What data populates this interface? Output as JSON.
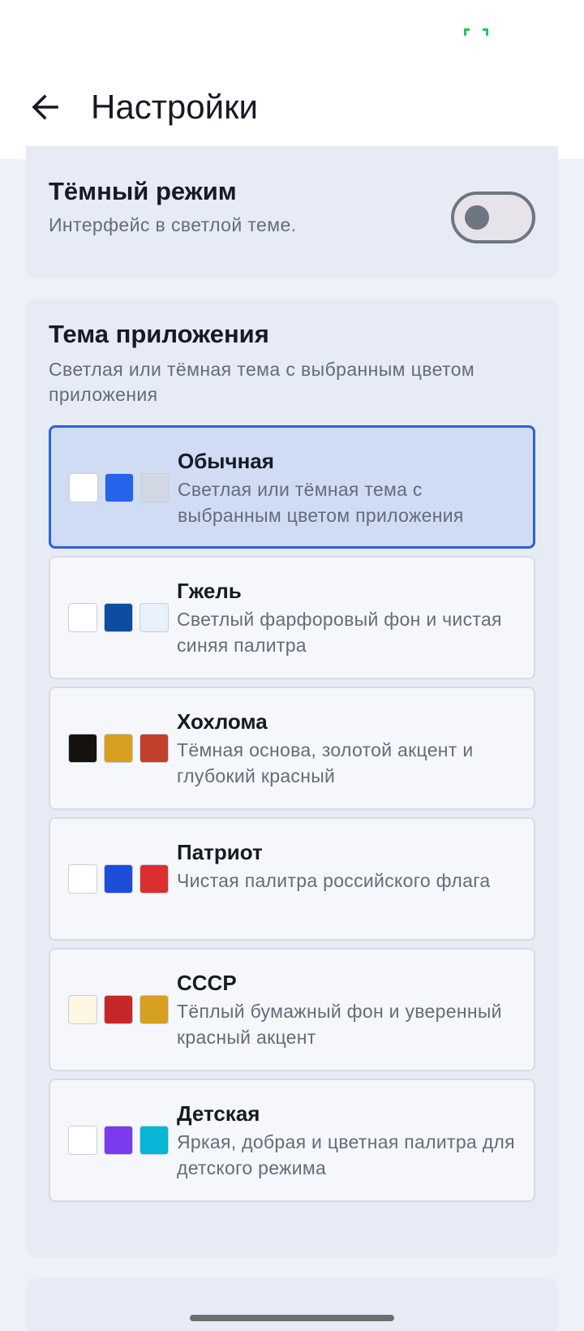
{
  "header": {
    "title": "Настройки",
    "back_icon": "arrow-left-icon"
  },
  "status_bar": {
    "indicator_icon": "screen-record-icon",
    "indicator_color": "#22c55e"
  },
  "dark_mode": {
    "title": "Тёмный режим",
    "subtitle": "Интерфейс в светлой теме.",
    "enabled": false
  },
  "theme": {
    "title": "Тема приложения",
    "subtitle": "Светлая или тёмная тема с выбранным цветом приложения",
    "options": [
      {
        "name": "Обычная",
        "description": "Светлая или тёмная тема с выбранным цветом приложения",
        "selected": true,
        "swatches": [
          "#ffffff",
          "#2563eb",
          "#d2d8e3"
        ]
      },
      {
        "name": "Гжель",
        "description": "Светлый фарфоровый фон и чистая синяя палитра",
        "selected": false,
        "swatches": [
          "#ffffff",
          "#0d4da1",
          "#e8f0fb"
        ]
      },
      {
        "name": "Хохлома",
        "description": "Тёмная основа, золотой акцент и глубокий красный",
        "selected": false,
        "swatches": [
          "#16120e",
          "#d8a020",
          "#c0402c"
        ]
      },
      {
        "name": "Патриот",
        "description": "Чистая палитра российского флага",
        "selected": false,
        "swatches": [
          "#ffffff",
          "#1d4ed8",
          "#dc2e2e"
        ]
      },
      {
        "name": "СССР",
        "description": "Тёплый бумажный фон и уверенный красный акцент",
        "selected": false,
        "swatches": [
          "#fdf6e3",
          "#c62828",
          "#d8a020"
        ]
      },
      {
        "name": "Детская",
        "description": "Яркая, добрая и цветная палитра для детского режима",
        "selected": false,
        "swatches": [
          "#ffffff",
          "#7c3aed",
          "#06b6d4"
        ]
      }
    ]
  },
  "colors": {
    "accent": "#2d62d6",
    "selected_background": "#cfdcf4",
    "card_background": "#e6ebf5"
  }
}
